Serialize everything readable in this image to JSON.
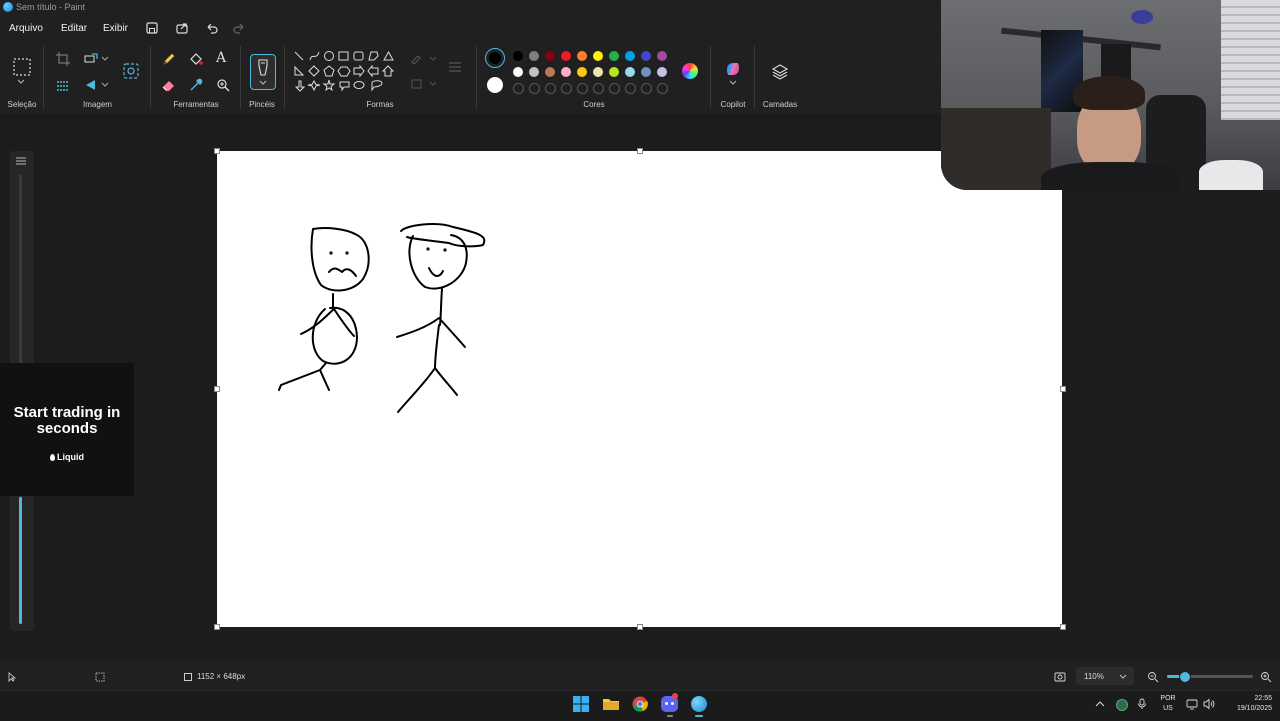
{
  "window": {
    "title": "Sem título - Paint"
  },
  "menu": {
    "file": "Arquivo",
    "edit": "Editar",
    "view": "Exibir"
  },
  "ribbon": {
    "groups": {
      "selection": "Seleção",
      "image": "Imagem",
      "tools": "Ferramentas",
      "brushes": "Pincéis",
      "shapes": "Formas",
      "colors": "Cores",
      "copilot": "Copilot",
      "layers": "Camadas"
    },
    "colors": {
      "primary": "#000000",
      "secondary": "#ffffff",
      "palette_row1": [
        "#000000",
        "#7f7f7f",
        "#880015",
        "#ed1c24",
        "#ff7f27",
        "#fff200",
        "#22b14c",
        "#00a2e8",
        "#3f48cc",
        "#a349a4"
      ],
      "palette_row2": [
        "#ffffff",
        "#c3c3c3",
        "#b97a57",
        "#ffaec9",
        "#ffc90e",
        "#efe4b0",
        "#b5e61d",
        "#99d9ea",
        "#7092be",
        "#c8bfe7"
      ]
    }
  },
  "ad": {
    "headline": "Start trading in seconds",
    "brand": "Liquid"
  },
  "status": {
    "canvas_size": "1152 × 648px",
    "zoom": "110%",
    "zoom_fraction": 0.2
  },
  "taskbar": {
    "language_top": "POR",
    "language_bottom": "US",
    "time": "22:55",
    "date": "19/10/2025"
  }
}
